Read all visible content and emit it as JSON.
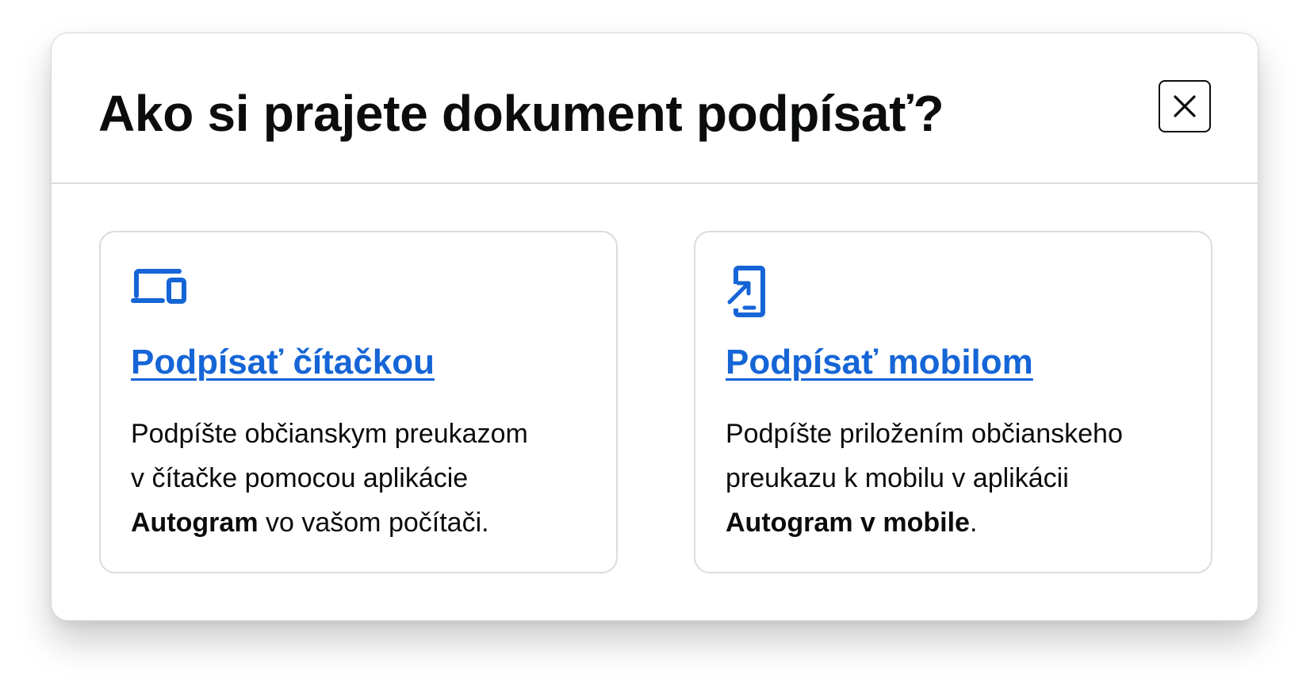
{
  "dialog": {
    "title": "Ako si prajete dokument podpísať?",
    "close_icon": "close-icon"
  },
  "options": [
    {
      "icon": "devices-icon",
      "link_label": "Podpísať čítačkou",
      "desc_line1": "Podpíšte občianskym preukazom",
      "desc_line2": "v čítačke pomocou aplikácie",
      "desc_bold": "Autogram",
      "desc_tail": " vo vašom počítači."
    },
    {
      "icon": "mobile-tap-icon",
      "link_label": "Podpísať mobilom",
      "desc_line1": "Podpíšte priložením občianskeho",
      "desc_line2": "preukazu k mobilu v aplikácii",
      "desc_bold": "Autogram v mobile",
      "desc_tail": "."
    }
  ],
  "colors": {
    "link": "#1565d6",
    "text": "#0b0c0c",
    "border": "#dcdcdc"
  }
}
